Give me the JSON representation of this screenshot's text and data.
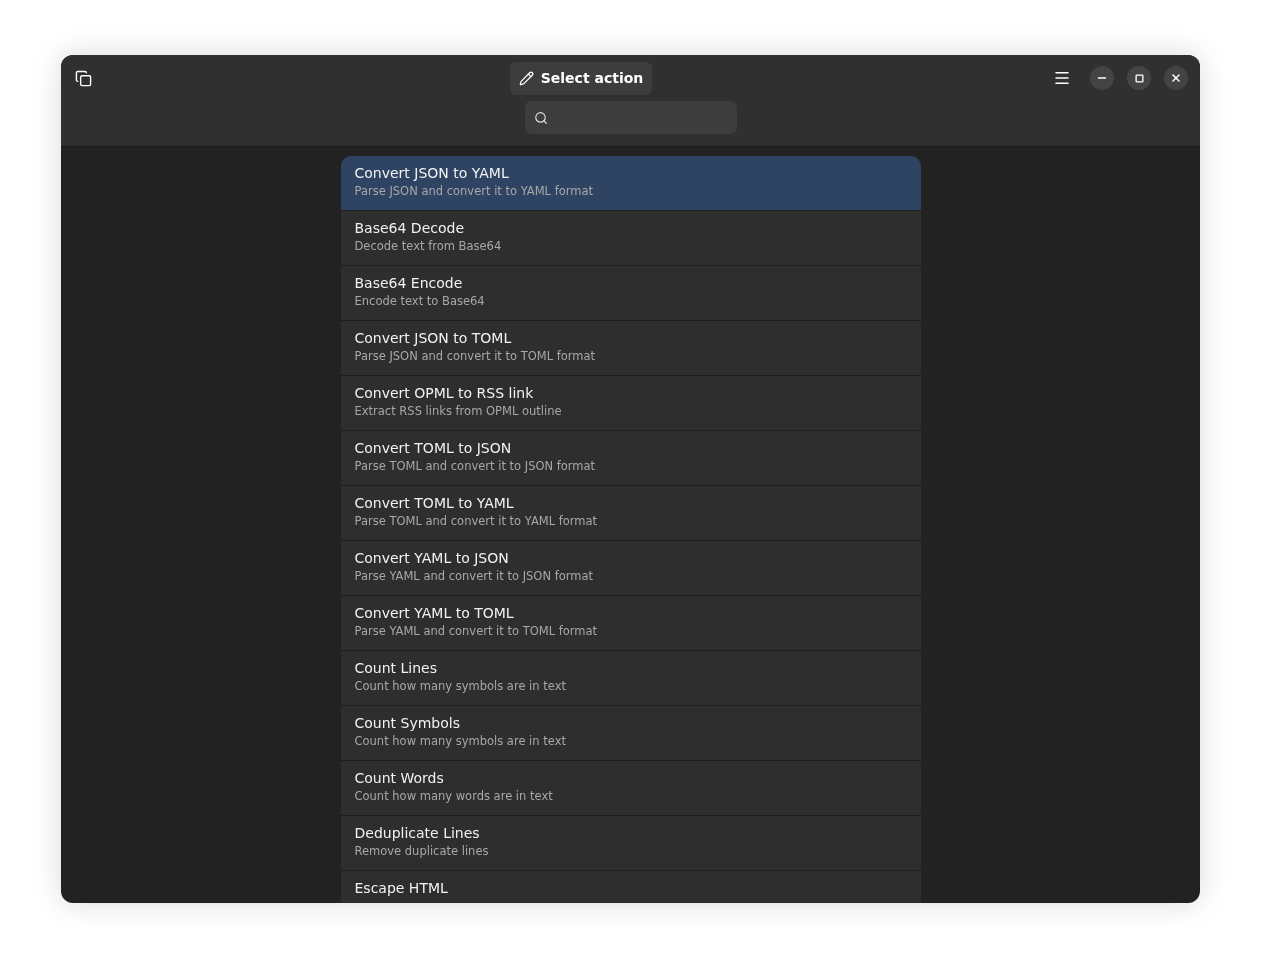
{
  "header": {
    "title_button": "Select action"
  },
  "actions": [
    {
      "title": "Convert JSON to YAML",
      "description": "Parse JSON and convert it to YAML format",
      "selected": true
    },
    {
      "title": "Base64 Decode",
      "description": "Decode text from Base64",
      "selected": false
    },
    {
      "title": "Base64 Encode",
      "description": "Encode text to Base64",
      "selected": false
    },
    {
      "title": "Convert JSON to TOML",
      "description": "Parse JSON and convert it to TOML format",
      "selected": false
    },
    {
      "title": "Convert OPML to RSS link",
      "description": "Extract RSS links from OPML outline",
      "selected": false
    },
    {
      "title": "Convert TOML to JSON",
      "description": "Parse TOML and convert it to JSON format",
      "selected": false
    },
    {
      "title": "Convert TOML to YAML",
      "description": "Parse TOML and convert it to YAML format",
      "selected": false
    },
    {
      "title": "Convert YAML to JSON",
      "description": "Parse YAML and convert it to JSON format",
      "selected": false
    },
    {
      "title": "Convert YAML to TOML",
      "description": "Parse YAML and convert it to TOML format",
      "selected": false
    },
    {
      "title": "Count Lines",
      "description": "Count how many symbols are in text",
      "selected": false
    },
    {
      "title": "Count Symbols",
      "description": "Count how many symbols are in text",
      "selected": false
    },
    {
      "title": "Count Words",
      "description": "Count how many words are in text",
      "selected": false
    },
    {
      "title": "Deduplicate Lines",
      "description": "Remove duplicate lines",
      "selected": false
    },
    {
      "title": "Escape HTML",
      "selected": false
    }
  ]
}
